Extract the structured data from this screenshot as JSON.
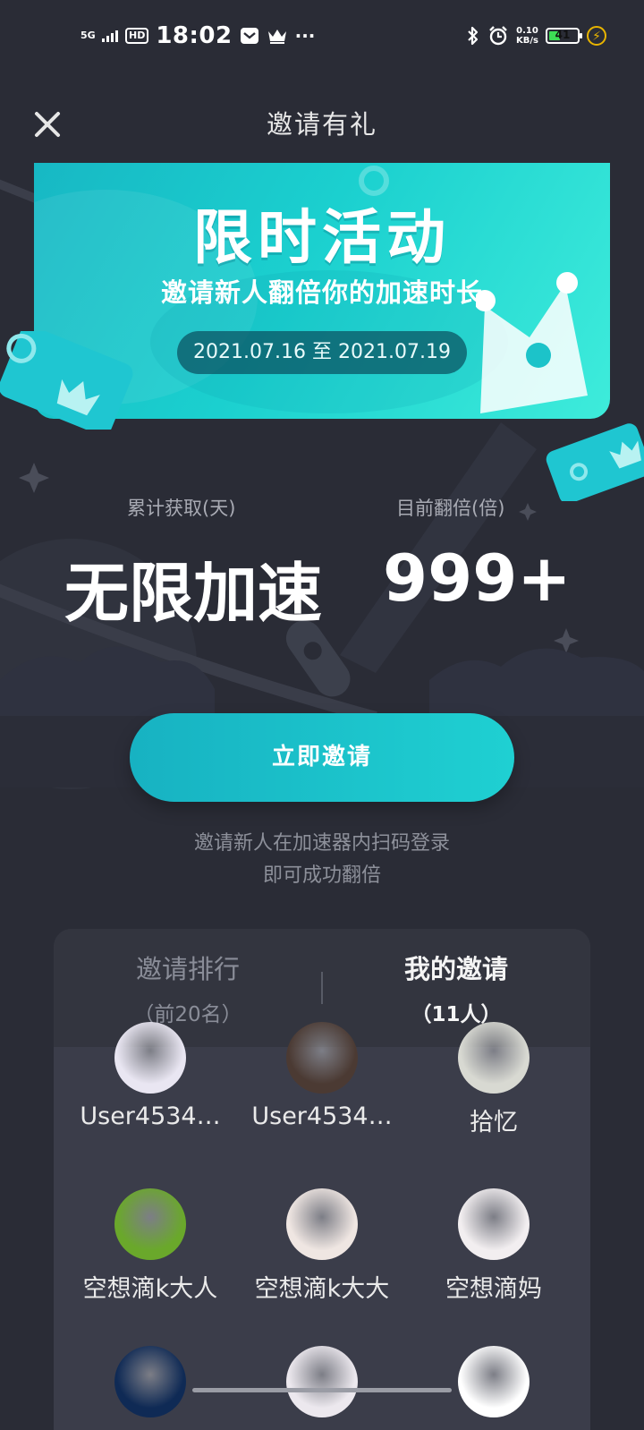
{
  "status_bar": {
    "network": "5G",
    "hd": "HD",
    "time": "18:02",
    "speed_value": "0.10",
    "speed_unit": "KB/s",
    "battery": "41",
    "battery_level": 0.41,
    "more": "···"
  },
  "nav": {
    "title": "邀请有礼"
  },
  "banner": {
    "title": "限时活动",
    "subtitle": "邀请新人翻倍你的加速时长",
    "date_range": "2021.07.16 至 2021.07.19"
  },
  "stats": {
    "left_label": "累计获取(天)",
    "left_value": "无限加速",
    "right_label": "目前翻倍(倍)",
    "right_value": "999+"
  },
  "invite_button": "立即邀请",
  "hint": {
    "line1": "邀请新人在加速器内扫码登录",
    "line2": "即可成功翻倍"
  },
  "tabs": [
    {
      "label": "邀请排行",
      "sub": "（前20名）"
    },
    {
      "label": "我的邀请",
      "sub": "（11人）"
    }
  ],
  "users": [
    {
      "name": "User4534…",
      "avatar_color": "#e9e6f2"
    },
    {
      "name": "User4534…",
      "avatar_color": "#4b3a33"
    },
    {
      "name": "拾忆",
      "avatar_color": "#d8d9d2"
    },
    {
      "name": "空想滴k大人",
      "avatar_color": "#6aa82b"
    },
    {
      "name": "空想滴k大大",
      "avatar_color": "#efe6e2"
    },
    {
      "name": "空想滴妈",
      "avatar_color": "#f2eef0"
    },
    {
      "name": "",
      "avatar_color": "#0f2a55"
    },
    {
      "name": "",
      "avatar_color": "#ece8ee"
    },
    {
      "name": "",
      "avatar_color": "#ffffff"
    }
  ]
}
